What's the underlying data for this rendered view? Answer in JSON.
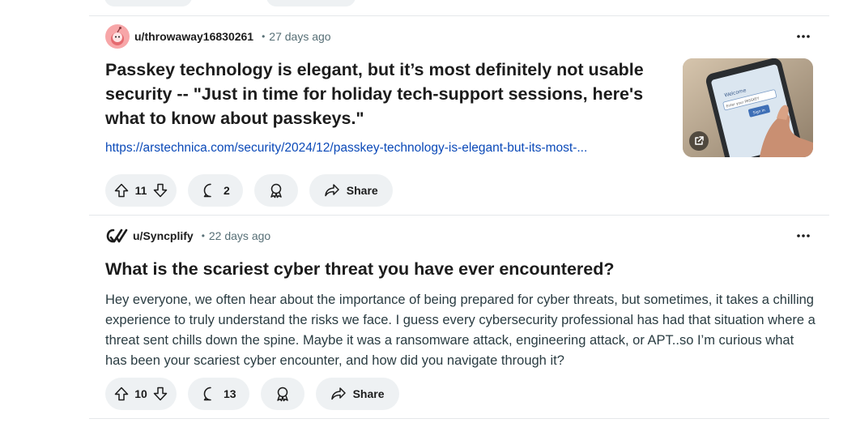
{
  "posts": [
    {
      "author": "u/throwaway16830261",
      "time": "27 days ago",
      "title": "Passkey technology is elegant, but it’s most definitely not usable security -- \"Just in time for holiday tech-support sessions, here's what to know about passkeys.\"",
      "link": "https://arstechnica.com/security/2024/12/passkey-technology-is-elegant-but-its-most-...",
      "thumbnail_text": [
        "Welcome",
        "Enter your PASSKEY",
        "Sign in"
      ],
      "upvotes": "11",
      "comments": "2",
      "share_label": "Share"
    },
    {
      "author": "u/Syncplify",
      "time": "22 days ago",
      "title": "What is the scariest cyber threat you have ever encountered?",
      "body": "Hey everyone, we often hear about the importance of being prepared for cyber threats, but sometimes, it takes a chilling experience to truly understand the risks we face. I guess every cybersecurity professional has had that situation where a threat sent chills down the spine. Maybe it was a ransomware attack, engineering attack, or APT..so I’m curious what has been your scariest cyber encounter, and how did you navigate through it?",
      "upvotes": "10",
      "comments": "13",
      "share_label": "Share"
    }
  ],
  "separator": "•",
  "icons": [
    "more-options-icon",
    "upvote-icon",
    "downvote-icon",
    "comment-icon",
    "award-icon",
    "share-icon",
    "external-link-icon"
  ],
  "colors": {
    "link": "#0a49b8",
    "button_bg": "#eef1f3",
    "meta": "#576f76",
    "avatar": "#f7a6a8"
  }
}
